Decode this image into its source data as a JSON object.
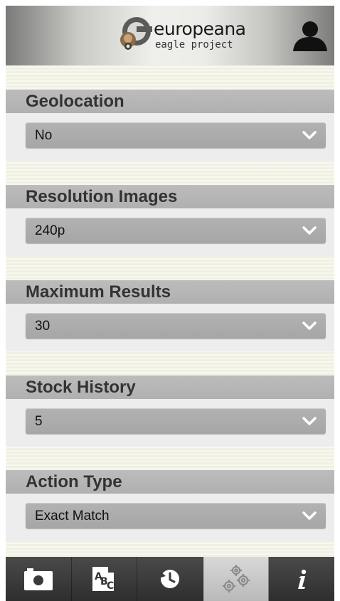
{
  "header": {
    "logo_title": "europeana",
    "logo_subtitle": "eagle project",
    "user_icon": "user-icon"
  },
  "settings": [
    {
      "label": "Geolocation",
      "value": "No"
    },
    {
      "label": "Resolution Images",
      "value": "240p"
    },
    {
      "label": "Maximum Results",
      "value": "30"
    },
    {
      "label": "Stock History",
      "value": "5"
    },
    {
      "label": "Action Type",
      "value": "Exact Match"
    }
  ],
  "tabbar": {
    "tabs": [
      {
        "icon": "camera-icon",
        "active": false
      },
      {
        "icon": "text-recognition-icon",
        "active": false
      },
      {
        "icon": "history-icon",
        "active": false
      },
      {
        "icon": "settings-gears-icon",
        "active": true
      },
      {
        "icon": "info-icon",
        "active": false
      }
    ]
  },
  "colors": {
    "section_header_bg": "#b6b6b6",
    "section_body_bg": "#ededed",
    "select_bg": "#aaaaaa",
    "tabbar_bg": "#3a3a3a",
    "active_tab_bg": "#c8c8c8"
  }
}
